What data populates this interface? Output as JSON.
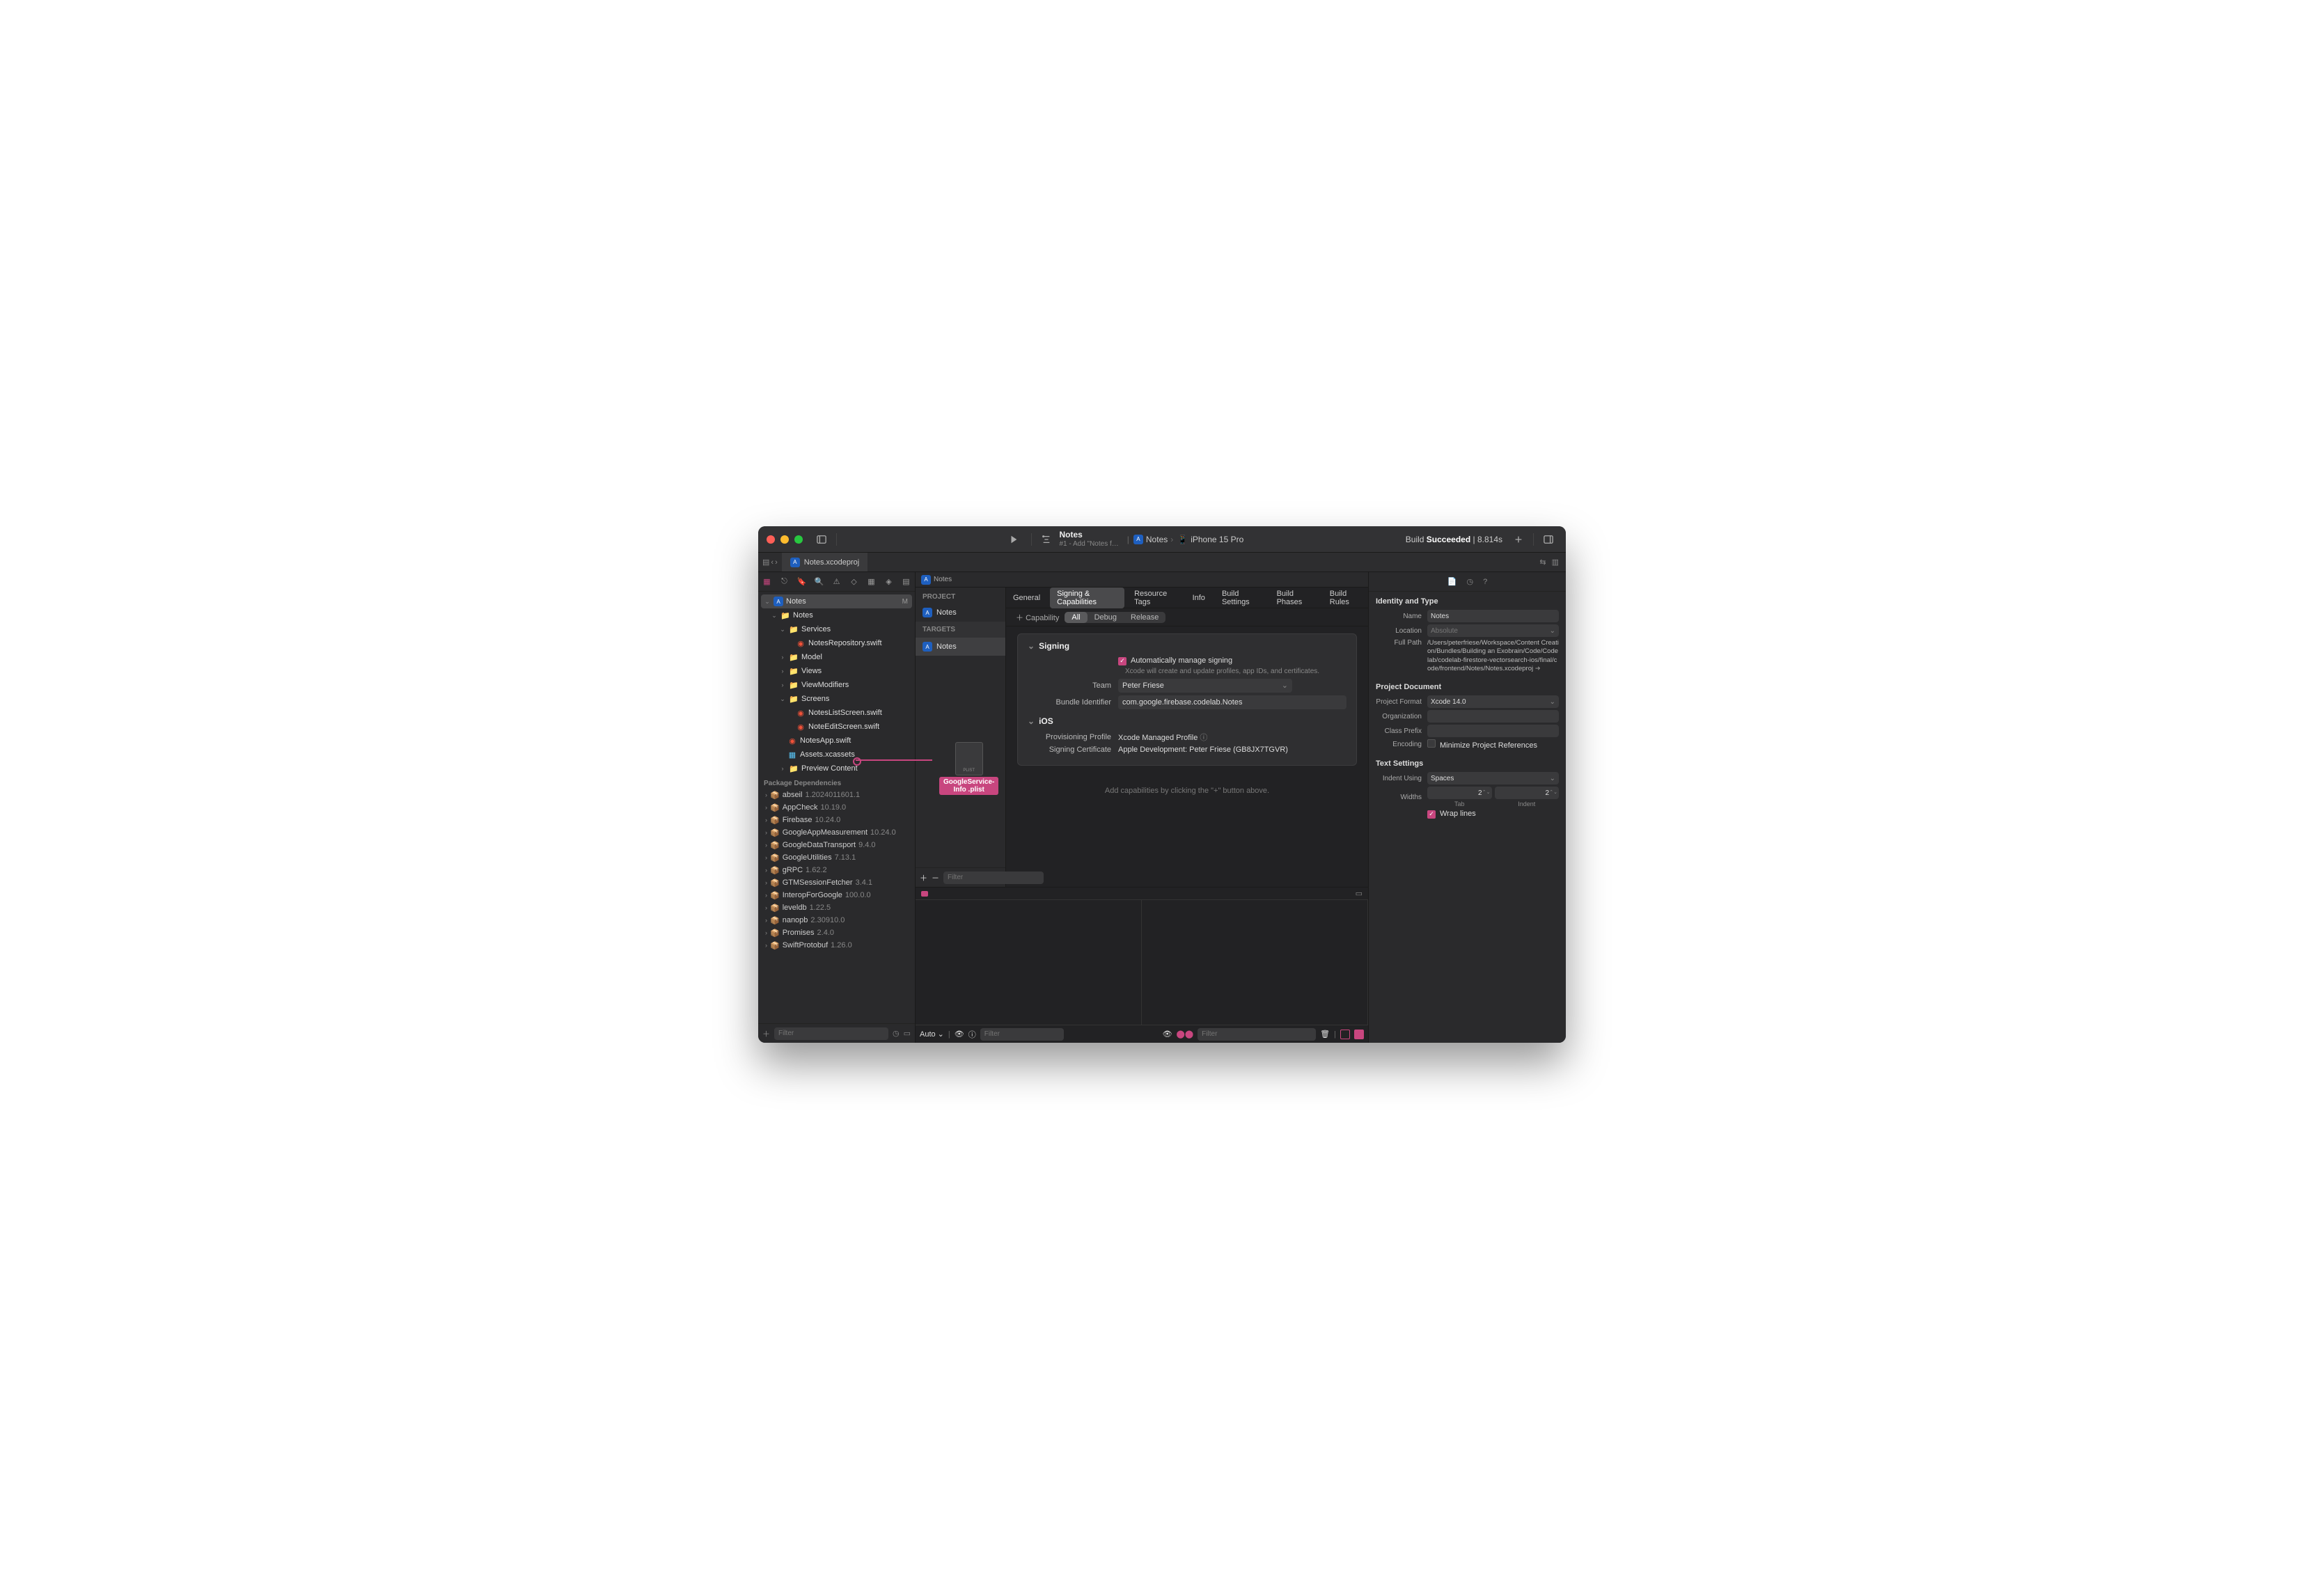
{
  "titlebar": {
    "project_name": "Notes",
    "subtitle": "#1 - Add \"Notes f…",
    "scheme_app": "Notes",
    "scheme_device": "iPhone 15 Pro",
    "status_prefix": "Build ",
    "status_bold": "Succeeded",
    "status_suffix": " | 8.814s"
  },
  "tabbar": {
    "active_tab": "Notes.xcodeproj"
  },
  "jumpbar": {
    "crumb": "Notes"
  },
  "navigator": {
    "root": "Notes",
    "root_status": "M",
    "folders": {
      "notes": "Notes",
      "services": "Services",
      "model": "Model",
      "views": "Views",
      "viewmodifiers": "ViewModifiers",
      "screens": "Screens",
      "preview": "Preview Content"
    },
    "files": {
      "notes_repo": "NotesRepository.swift",
      "notes_list": "NotesListScreen.swift",
      "note_edit": "NoteEditScreen.swift",
      "notes_app": "NotesApp.swift",
      "assets": "Assets.xcassets"
    },
    "pkg_header": "Package Dependencies",
    "packages": [
      {
        "name": "abseil",
        "ver": "1.2024011601.1"
      },
      {
        "name": "AppCheck",
        "ver": "10.19.0"
      },
      {
        "name": "Firebase",
        "ver": "10.24.0"
      },
      {
        "name": "GoogleAppMeasurement",
        "ver": "10.24.0"
      },
      {
        "name": "GoogleDataTransport",
        "ver": "9.4.0"
      },
      {
        "name": "GoogleUtilities",
        "ver": "7.13.1"
      },
      {
        "name": "gRPC",
        "ver": "1.62.2"
      },
      {
        "name": "GTMSessionFetcher",
        "ver": "3.4.1"
      },
      {
        "name": "InteropForGoogle",
        "ver": "100.0.0"
      },
      {
        "name": "leveldb",
        "ver": "1.22.5"
      },
      {
        "name": "nanopb",
        "ver": "2.30910.0"
      },
      {
        "name": "Promises",
        "ver": "2.4.0"
      },
      {
        "name": "SwiftProtobuf",
        "ver": "1.26.0"
      }
    ],
    "filter_placeholder": "Filter"
  },
  "drag": {
    "filetype": "PLIST",
    "label_line1": "GoogleService-",
    "label_line2": "Info .plist"
  },
  "project_editor": {
    "section_project": "PROJECT",
    "section_targets": "TARGETS",
    "project_name": "Notes",
    "target_name": "Notes",
    "filter_placeholder": "Filter",
    "tabs": {
      "general": "General",
      "signing": "Signing & Capabilities",
      "resource": "Resource Tags",
      "info": "Info",
      "build_settings": "Build Settings",
      "build_phases": "Build Phases",
      "build_rules": "Build Rules"
    },
    "capability_btn": "Capability",
    "segments": {
      "all": "All",
      "debug": "Debug",
      "release": "Release"
    },
    "signing": {
      "title": "Signing",
      "auto_label": "Automatically manage signing",
      "auto_help": "Xcode will create and update profiles, app IDs, and certificates.",
      "team_label": "Team",
      "team_value": "Peter Friese",
      "bundle_label": "Bundle Identifier",
      "bundle_value": "com.google.firebase.codelab.Notes",
      "ios_title": "iOS",
      "prov_label": "Provisioning Profile",
      "prov_value": "Xcode Managed Profile",
      "cert_label": "Signing Certificate",
      "cert_value": "Apple Development: Peter Friese (GB8JX7TGVR)"
    },
    "placeholder": "Add capabilities by clicking the \"+\" button above."
  },
  "debug": {
    "auto": "Auto ⌄",
    "filter_placeholder": "Filter"
  },
  "inspector": {
    "sec_identity": "Identity and Type",
    "name_label": "Name",
    "name_value": "Notes",
    "location_label": "Location",
    "location_value": "Absolute",
    "fullpath_label": "Full Path",
    "fullpath_value": "/Users/peterfriese/Workspace/Content Creation/Bundles/Building an Exobrain/Code/Codelab/codelab-firestore-vectorsearch-ios/final/code/frontend/Notes/Notes.xcodeproj",
    "sec_projdoc": "Project Document",
    "format_label": "Project Format",
    "format_value": "Xcode 14.0",
    "org_label": "Organization",
    "prefix_label": "Class Prefix",
    "encoding_label": "Encoding",
    "minimize_label": "Minimize Project References",
    "sec_text": "Text Settings",
    "indent_label": "Indent Using",
    "indent_value": "Spaces",
    "widths_label": "Widths",
    "tab_value": "2",
    "indent_value_num": "2",
    "tab_caption": "Tab",
    "indent_caption": "Indent",
    "wrap_label": "Wrap lines"
  }
}
